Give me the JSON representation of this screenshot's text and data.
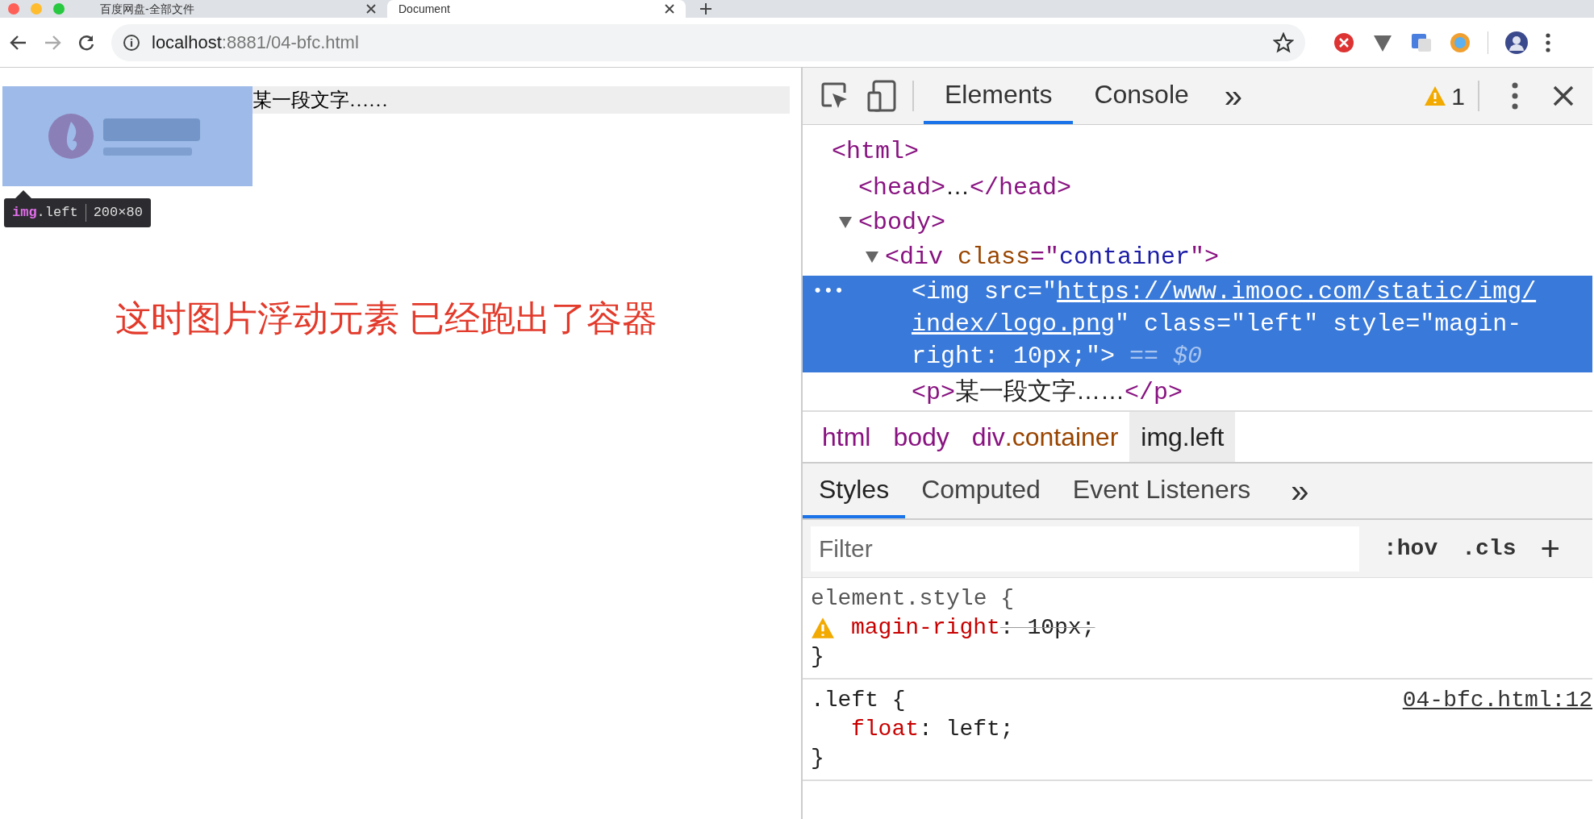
{
  "browser": {
    "tabs": [
      {
        "title": "百度网盘-全部文件",
        "selected": false
      },
      {
        "title": "Document",
        "selected": true
      }
    ],
    "address": {
      "host": "localhost",
      "rest": ":8881/04-bfc.html"
    }
  },
  "page": {
    "paragraph": "某一段文字……",
    "tooltip": {
      "tag": "img",
      "cls": ".left",
      "size": "200×80"
    },
    "annotation": "这时图片浮动元素 已经跑出了容器"
  },
  "devtools": {
    "tabs": [
      {
        "label": "Elements",
        "selected": true
      },
      {
        "label": "Console",
        "selected": false
      }
    ],
    "more": "»",
    "warning_count": "1",
    "dom": [
      {
        "selected": false,
        "parts": [
          {
            "kind": "tag",
            "text": "<html>"
          }
        ],
        "children": [
          {
            "selected": false,
            "parts": [
              {
                "kind": "tag",
                "text": "<head>"
              },
              {
                "kind": "text",
                "text": "…"
              },
              {
                "kind": "tag",
                "text": "</head>"
              }
            ]
          },
          {
            "selected": false,
            "expanded": true,
            "parts": [
              {
                "kind": "tag",
                "text": "<body>"
              }
            ],
            "children": [
              {
                "selected": false,
                "expanded": true,
                "parts": [
                  {
                    "kind": "tag",
                    "text": "<div"
                  },
                  {
                    "kind": "attr",
                    "text": " class"
                  },
                  {
                    "kind": "punct",
                    "text": "=\""
                  },
                  {
                    "kind": "value",
                    "text": "container"
                  },
                  {
                    "kind": "punct",
                    "text": "\""
                  },
                  {
                    "kind": "tag",
                    "text": ">"
                  }
                ],
                "children": [
                  {
                    "selected": true,
                    "marker": "•••",
                    "parts": [
                      {
                        "kind": "tag",
                        "text": "<img"
                      },
                      {
                        "kind": "attr",
                        "text": " src"
                      },
                      {
                        "kind": "punct",
                        "text": "=\""
                      },
                      {
                        "kind": "link",
                        "text": "https://www.imooc.com/static/img/index/logo.png"
                      },
                      {
                        "kind": "punct",
                        "text": "\""
                      },
                      {
                        "kind": "attr",
                        "text": " class"
                      },
                      {
                        "kind": "punct",
                        "text": "=\""
                      },
                      {
                        "kind": "value",
                        "text": "left"
                      },
                      {
                        "kind": "punct",
                        "text": "\""
                      },
                      {
                        "kind": "attr",
                        "text": " style"
                      },
                      {
                        "kind": "punct",
                        "text": "=\""
                      },
                      {
                        "kind": "value",
                        "text": "magin-right: 10px;"
                      },
                      {
                        "kind": "punct",
                        "text": "\""
                      },
                      {
                        "kind": "tag",
                        "text": ">"
                      },
                      {
                        "kind": "ref",
                        "text": " == $0"
                      }
                    ]
                  },
                  {
                    "selected": false,
                    "parts": [
                      {
                        "kind": "tag",
                        "text": "<p>"
                      },
                      {
                        "kind": "text",
                        "text": "某一段文字……"
                      },
                      {
                        "kind": "tag",
                        "text": "</p>"
                      }
                    ]
                  }
                ]
              }
            ]
          }
        ]
      }
    ],
    "breadcrumbs": [
      {
        "tag": "html",
        "selected": false
      },
      {
        "tag": "body",
        "selected": false
      },
      {
        "tag": "div",
        "cls": ".container",
        "selected": false
      },
      {
        "tag": "img.left",
        "selected": true
      }
    ],
    "style_tabs": [
      {
        "label": "Styles",
        "selected": true
      },
      {
        "label": "Computed",
        "selected": false
      },
      {
        "label": "Event Listeners",
        "selected": false
      }
    ],
    "style_more": "»",
    "filter": {
      "placeholder": "Filter"
    },
    "hov": ":hov",
    "cls": ".cls",
    "add": "+",
    "rules": [
      {
        "selector": "element.style {",
        "close": "}",
        "declarations": [
          {
            "property": "magin-right",
            "rest": ": 10px;",
            "invalid": true
          }
        ]
      },
      {
        "selector": ".left {",
        "source": "04-bfc.html:12",
        "close": "}",
        "declarations": [
          {
            "property": "float",
            "rest": ": left;",
            "invalid": false
          }
        ]
      }
    ]
  }
}
